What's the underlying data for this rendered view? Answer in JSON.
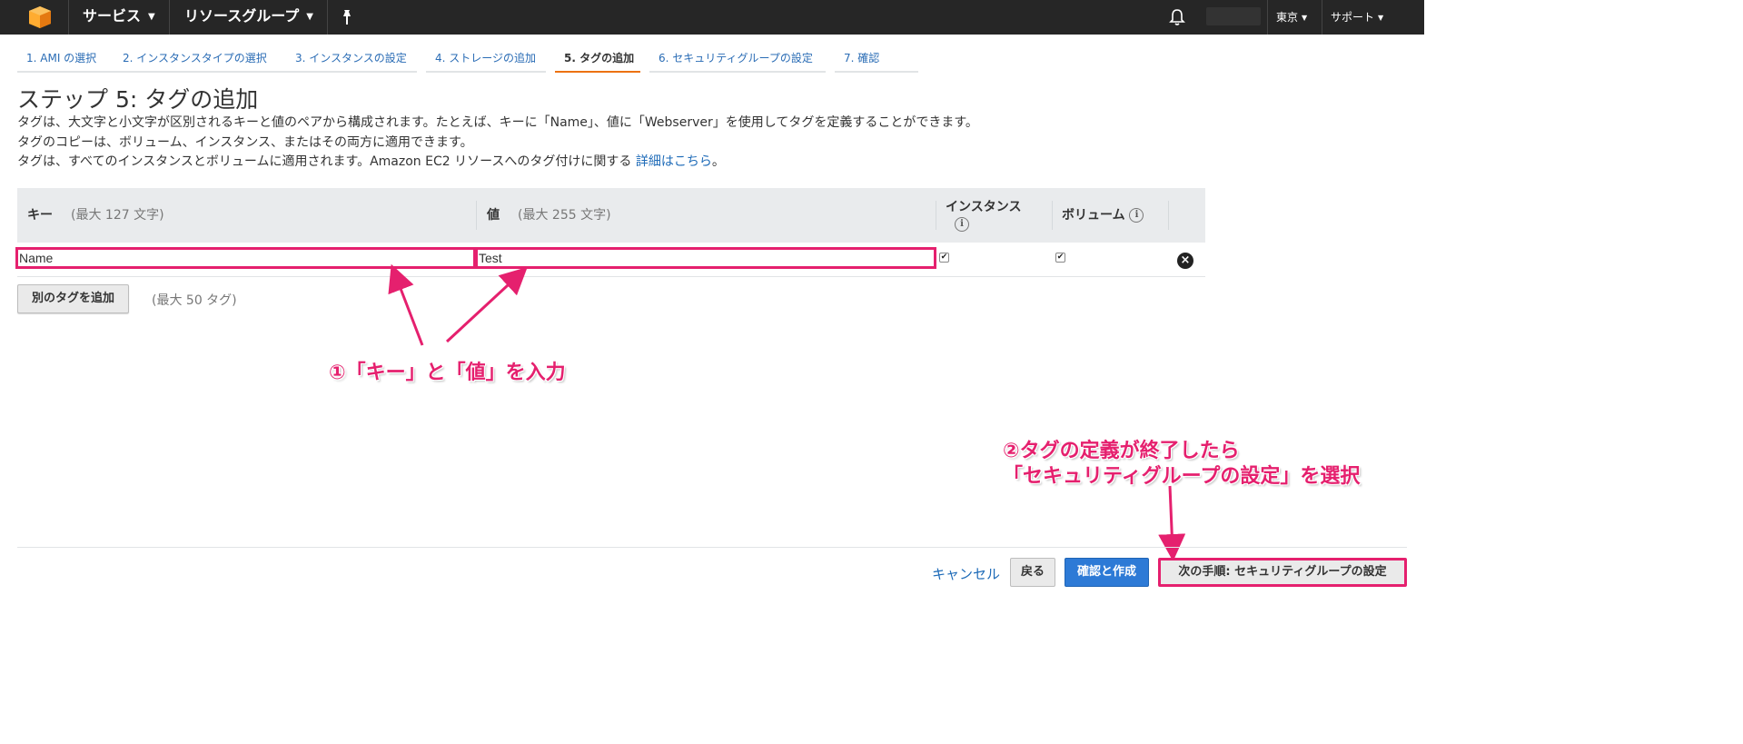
{
  "nav": {
    "services": "サービス",
    "resource_groups": "リソースグループ",
    "region": "東京",
    "support": "サポート"
  },
  "wizard": {
    "tabs": [
      {
        "label": "1. AMI の選択"
      },
      {
        "label": "2. インスタンスタイプの選択"
      },
      {
        "label": "3. インスタンスの設定"
      },
      {
        "label": "4. ストレージの追加"
      },
      {
        "label": "5. タグの追加"
      },
      {
        "label": "6. セキュリティグループの設定"
      },
      {
        "label": "7. 確認"
      }
    ],
    "active_tab": 4
  },
  "page": {
    "title": "ステップ 5: タグの追加",
    "desc1": "タグは、大文字と小文字が区別されるキーと値のペアから構成されます。たとえば、キーに「Name」、値に「Webserver」を使用してタグを定義することができます。",
    "desc2": "タグのコピーは、ボリューム、インスタンス、またはその両方に適用できます。",
    "desc3_prefix": "タグは、すべてのインスタンスとボリュームに適用されます。Amazon EC2 リソースへのタグ付けに関する ",
    "desc3_link": "詳細はこちら",
    "desc3_suffix": "。"
  },
  "table": {
    "key_header": "キー",
    "key_hint": "(最大 127 文字)",
    "value_header": "値",
    "value_hint": "(最大 255 文字)",
    "instances_header": "インスタンス",
    "volumes_header": "ボリューム",
    "rows": [
      {
        "key": "Name",
        "value": "Test",
        "instances": true,
        "volumes": true
      }
    ]
  },
  "add_tag": {
    "button": "別のタグを追加",
    "hint": "(最大 50 タグ)"
  },
  "annotations": {
    "note1": "①「キー」と「値」を入力",
    "note2_line1": "②タグの定義が終了したら",
    "note2_line2": "「セキュリティグループの設定」を選択",
    "color": "#e5206e"
  },
  "footer": {
    "cancel": "キャンセル",
    "back": "戻る",
    "review_launch": "確認と作成",
    "next": "次の手順: セキュリティグループの設定"
  },
  "colors": {
    "nav_bg": "#262626",
    "link": "#1e6bb8",
    "primary_button": "#2d7ad6",
    "active_tab_border": "#ec7211"
  }
}
